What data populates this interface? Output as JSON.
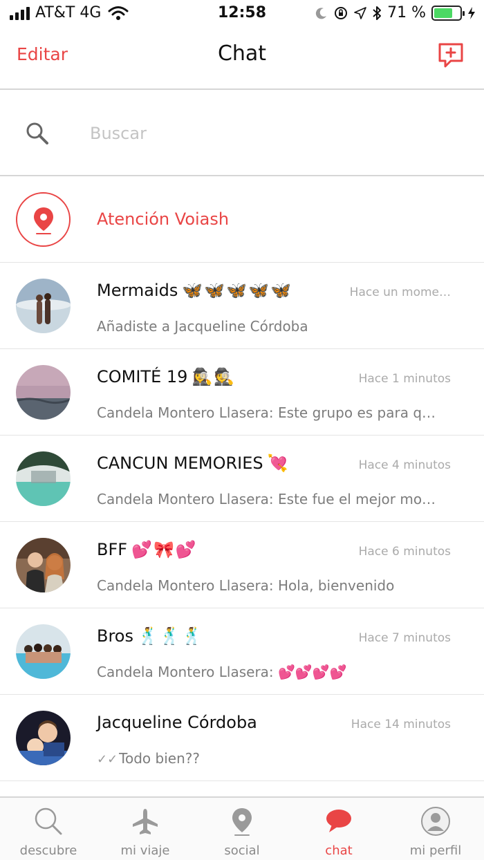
{
  "status_bar": {
    "carrier": "AT&T 4G",
    "time": "12:58",
    "battery_percent": "71 %",
    "battery_level": 0.71
  },
  "header": {
    "edit_label": "Editar",
    "title": "Chat",
    "compose_icon": "new-message-icon"
  },
  "search": {
    "placeholder": "Buscar",
    "value": ""
  },
  "support": {
    "label": "Atención Voiash",
    "icon": "location-pin-icon"
  },
  "chats": [
    {
      "name": "Mermaids",
      "emoji": "🦋🦋🦋🦋🦋",
      "time": "Hace un mome…",
      "preview": "Añadiste a Jacqueline  Córdoba",
      "read": false
    },
    {
      "name": "COMITÉ 19",
      "emoji": "🕵️‍♀️🕵️",
      "time": "Hace 1 minutos",
      "preview": "Candela Montero Llasera: Este grupo es para q…",
      "read": false
    },
    {
      "name": "CANCUN MEMORIES",
      "emoji": "💘",
      "time": "Hace 4 minutos",
      "preview": "Candela Montero Llasera: Este fue el mejor mo…",
      "read": false
    },
    {
      "name": "BFF",
      "emoji": "💕🎀💕",
      "time": "Hace 6 minutos",
      "preview": "Candela Montero Llasera: Hola, bienvenido",
      "read": false
    },
    {
      "name": "Bros",
      "emoji": "🕺🕺🕺",
      "time": "Hace 7 minutos",
      "preview": "Candela Montero Llasera: 💕💕💕💕",
      "read": false
    },
    {
      "name": "Jacqueline  Córdoba",
      "emoji": "",
      "time": "Hace 14 minutos",
      "preview": "Todo bien??",
      "read": true
    }
  ],
  "tabs": [
    {
      "label": "descubre",
      "icon": "search-icon",
      "active": false
    },
    {
      "label": "mi viaje",
      "icon": "airplane-icon",
      "active": false
    },
    {
      "label": "social",
      "icon": "location-pin-icon",
      "active": false
    },
    {
      "label": "chat",
      "icon": "chat-bubble-icon",
      "active": true
    },
    {
      "label": "mi perfil",
      "icon": "profile-icon",
      "active": false
    }
  ],
  "colors": {
    "accent": "#e94545",
    "battery": "#4cd964"
  }
}
